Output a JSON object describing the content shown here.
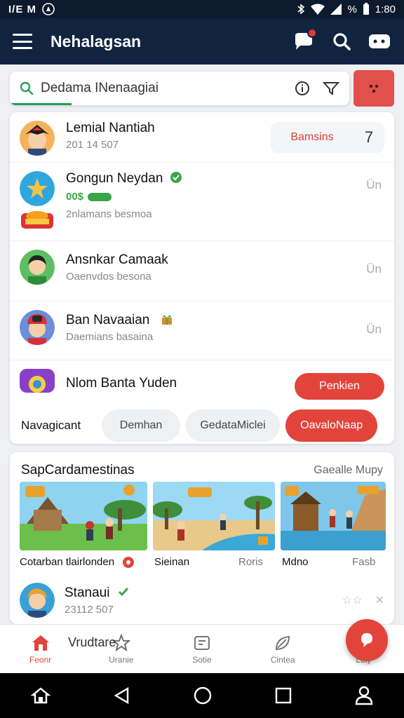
{
  "status": {
    "left": "I/E M",
    "battery": "%",
    "time": "1:80"
  },
  "appbar": {
    "title": "Nehalagsan"
  },
  "search": {
    "query": "Dedama INenaagiai"
  },
  "list": [
    {
      "name": "Lemial Nantiah",
      "sub": "201 14 507",
      "button": "Bamsins",
      "count": "7"
    },
    {
      "name": "Gongun Neydan",
      "tag": "00$",
      "sub": "2nlamans besmoa",
      "meta": "Ün"
    },
    {
      "name": "Ansnkar Camaak",
      "sub": "Oaenvdos besona",
      "meta": "Ün"
    },
    {
      "name": "Ban Navaaian",
      "sub": "Daemians basaina",
      "meta": "Ün"
    },
    {
      "name": "Nlom Banta Yuden",
      "button": "Penkien"
    }
  ],
  "tabs": {
    "label": "Navagicant",
    "items": [
      "Demhan",
      "GedataMiclei",
      "OavaloNaap"
    ]
  },
  "games": {
    "title": "SapCardamestinas",
    "more": "Gaealle Mupy",
    "captions": [
      "Cotarban tlairlonden",
      "Sieinan",
      "Roris",
      "Mdno",
      "Fasb"
    ]
  },
  "friend": {
    "name": "Stanaui",
    "sub": "23112 507",
    "stars": "☆☆",
    "close": "✕"
  },
  "bottomnav": [
    {
      "label": "Feonr",
      "icon": "home-icon"
    },
    {
      "label": "Uranie",
      "icon": "star-icon"
    },
    {
      "label": "Sotie",
      "icon": "message-icon"
    },
    {
      "label": "Cintea",
      "icon": "leaf-icon"
    },
    {
      "label": "Loly",
      "icon": "star-outline-icon"
    }
  ],
  "nav_overlay": "Vrudtare",
  "colors": {
    "accent": "#e2443b",
    "appbar": "#102440",
    "green": "#22a35a"
  }
}
